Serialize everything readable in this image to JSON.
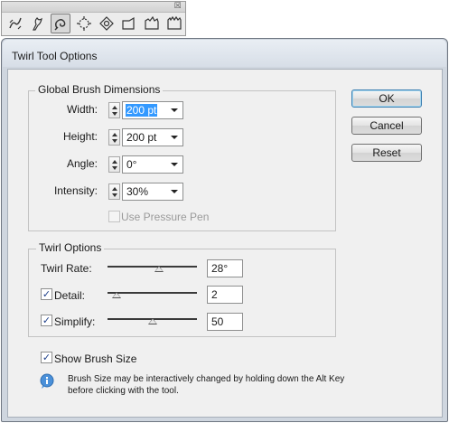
{
  "palette": {
    "close_glyph": "☒",
    "tools": [
      {
        "icon": "width-tool-icon"
      },
      {
        "icon": "warp-tool-icon"
      },
      {
        "icon": "twirl-tool-icon",
        "active": true
      },
      {
        "icon": "pucker-tool-icon"
      },
      {
        "icon": "bloat-tool-icon"
      },
      {
        "icon": "scallop-tool-icon"
      },
      {
        "icon": "crystallize-tool-icon"
      },
      {
        "icon": "wrinkle-tool-icon"
      }
    ]
  },
  "dialog": {
    "title": "Twirl Tool Options"
  },
  "global_brush": {
    "legend": "Global Brush Dimensions",
    "width_label": "Width:",
    "width_value": "200 pt",
    "height_label": "Height:",
    "height_value": "200 pt",
    "angle_label": "Angle:",
    "angle_value": "0°",
    "intensity_label": "Intensity:",
    "intensity_value": "30%",
    "pressure_label": "Use Pressure Pen",
    "pressure_checked": false
  },
  "twirl_options": {
    "legend": "Twirl Options",
    "rate_label": "Twirl Rate:",
    "rate_value": "28°",
    "rate_level": 0.58,
    "detail_label": "Detail:",
    "detail_value": "2",
    "detail_checked": true,
    "detail_level": 0.1,
    "simplify_label": "Simplify:",
    "simplify_value": "50",
    "simplify_checked": true,
    "simplify_level": 0.5
  },
  "show_brush_size": {
    "label": "Show Brush Size",
    "checked": true
  },
  "note": "Brush Size may be interactively changed by holding down the Alt Key before clicking with the tool.",
  "buttons": {
    "ok": "OK",
    "cancel": "Cancel",
    "reset": "Reset"
  },
  "check_glyph": "✓",
  "colors": {
    "selection": "#3399ff",
    "default_button_border": "#3c7fb1"
  }
}
